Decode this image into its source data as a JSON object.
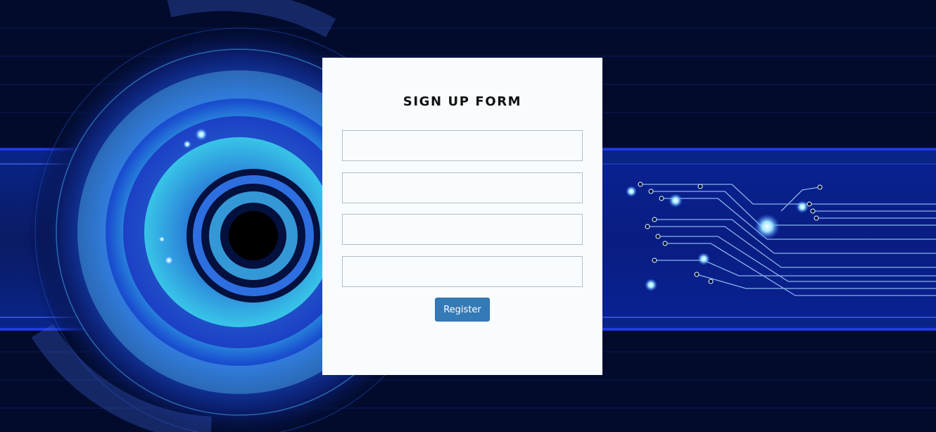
{
  "form": {
    "title": "SIGN UP FORM",
    "fields": [
      {
        "value": "",
        "placeholder": ""
      },
      {
        "value": "",
        "placeholder": ""
      },
      {
        "value": "",
        "placeholder": ""
      },
      {
        "value": "",
        "placeholder": ""
      }
    ],
    "submit_label": "Register"
  },
  "colors": {
    "background": "#020b2c",
    "card": "#f8fcff",
    "button": "#337ab7",
    "circuit_glow": "#6fb8ff"
  }
}
